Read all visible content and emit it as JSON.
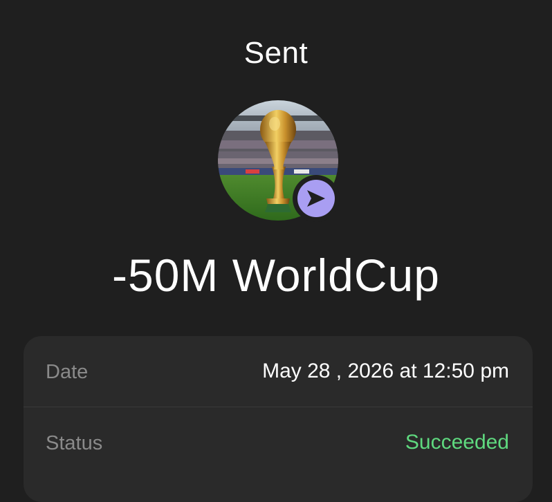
{
  "header": {
    "title": "Sent"
  },
  "transaction": {
    "avatar_icon": "world-cup-trophy-image",
    "badge_icon": "send-arrow-icon",
    "amount": "-50M WorldCup"
  },
  "details": {
    "date_label": "Date",
    "date_value": "May 28 , 2026 at 12:50 pm",
    "status_label": "Status",
    "status_value": "Succeeded"
  },
  "colors": {
    "background": "#1f1f1f",
    "card": "#2a2a2a",
    "badge": "#a99ef2",
    "success": "#5fd97f",
    "label": "#8a8a8a"
  }
}
